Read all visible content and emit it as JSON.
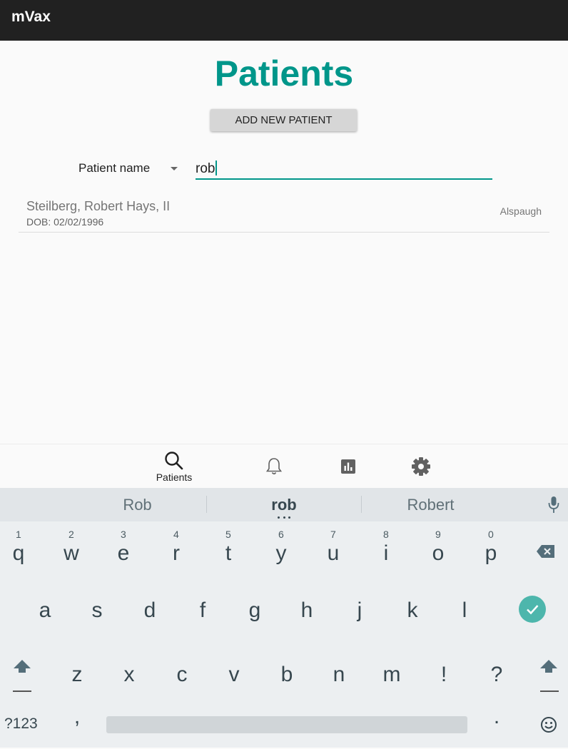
{
  "app": {
    "title": "mVax"
  },
  "page": {
    "title": "Patients",
    "add_button": "ADD NEW PATIENT"
  },
  "search": {
    "type_label": "Patient name",
    "query": "rob"
  },
  "results": [
    {
      "name": "Steilberg, Robert Hays, II",
      "dob": "DOB: 02/02/1996",
      "provider": "Alspaugh"
    }
  ],
  "bottom_nav": {
    "patients_label": "Patients"
  },
  "keyboard": {
    "suggestions": [
      "Rob",
      "rob",
      "Robert"
    ],
    "row1": [
      {
        "k": "q",
        "h": "1"
      },
      {
        "k": "w",
        "h": "2"
      },
      {
        "k": "e",
        "h": "3"
      },
      {
        "k": "r",
        "h": "4"
      },
      {
        "k": "t",
        "h": "5"
      },
      {
        "k": "y",
        "h": "6"
      },
      {
        "k": "u",
        "h": "7"
      },
      {
        "k": "i",
        "h": "8"
      },
      {
        "k": "o",
        "h": "9"
      },
      {
        "k": "p",
        "h": "0"
      }
    ],
    "row2": [
      "a",
      "s",
      "d",
      "f",
      "g",
      "h",
      "j",
      "k",
      "l"
    ],
    "row3": [
      "z",
      "x",
      "c",
      "v",
      "b",
      "n",
      "m",
      "!",
      "?"
    ],
    "symbols_label": "?123",
    "comma": ",",
    "period": "."
  }
}
